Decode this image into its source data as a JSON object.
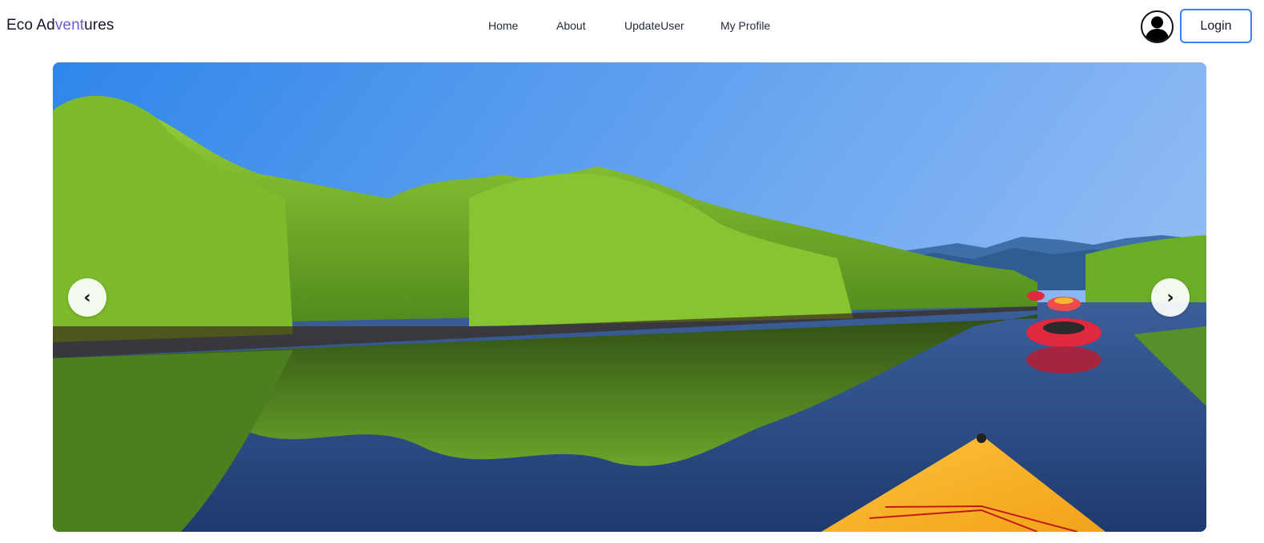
{
  "brand": {
    "part1": "Eco Ad",
    "part2": "vent",
    "part3": "ures"
  },
  "nav": {
    "home": "Home",
    "about": "About",
    "update_user": "UpdateUser",
    "my_profile": "My Profile"
  },
  "header": {
    "avatar_icon": "user-avatar-icon",
    "login_label": "Login"
  },
  "carousel": {
    "prev_icon": "‹",
    "next_icon": "›",
    "slide_image": "kayaks on mangrove river under blue sky"
  },
  "colors": {
    "brand_accent": "#6d5bd0",
    "login_border": "#3b82f6"
  }
}
